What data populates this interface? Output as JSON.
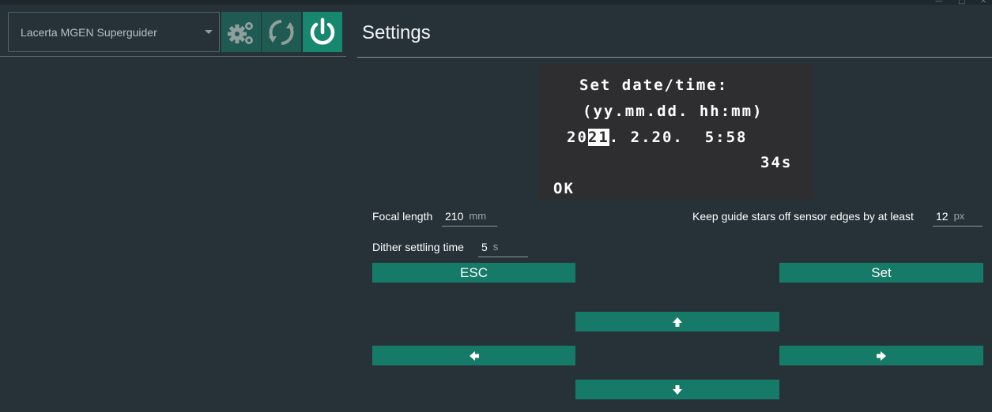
{
  "device": {
    "selected": "Lacerta MGEN Superguider"
  },
  "toolbar": {
    "settings_icon": "gears-icon",
    "refresh_icon": "refresh-icon",
    "power_icon": "power-icon"
  },
  "panel": {
    "title": "Settings"
  },
  "lcd": {
    "line1": "Set date/time:",
    "line2": "(yy.mm.dd. hh:mm)",
    "line3_prefix": "20",
    "line3_cursor": "21",
    "line3_suffix": ". 2.20.  5:58",
    "line4": "34s",
    "line5": "OK"
  },
  "focal_length": {
    "label": "Focal length",
    "value": "210",
    "unit": "mm"
  },
  "edge_margin": {
    "label": "Keep guide stars off sensor edges by at least",
    "value": "12",
    "unit": "px"
  },
  "dither": {
    "label": "Dither settling time",
    "value": "5",
    "unit": "s"
  },
  "buttons": {
    "esc": "ESC",
    "set": "Set",
    "up_icon": "arrow-up-icon",
    "down_icon": "arrow-down-icon",
    "left_icon": "arrow-left-icon",
    "right_icon": "arrow-right-icon"
  },
  "colors": {
    "background": "#263238",
    "accent": "#157a67",
    "lcd_background": "#2e2e30"
  }
}
